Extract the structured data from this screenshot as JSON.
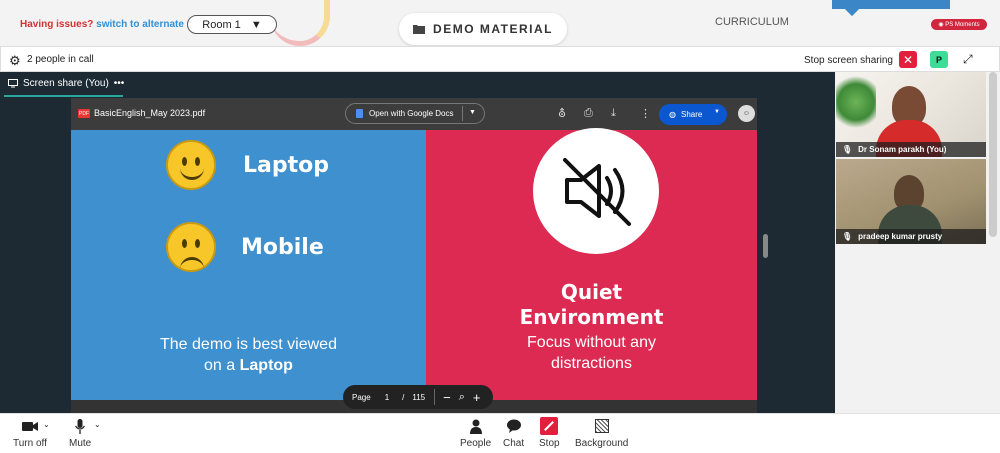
{
  "topbar": {
    "issues_text": "Having issues?",
    "alternate_link": "switch to alternate room",
    "room_select": "Room 1",
    "demo_tab": "DEMO MATERIAL",
    "curriculum": "CURRICULUM",
    "ps_moments": "PS Moments"
  },
  "callbar": {
    "people_count": "2 people in call",
    "stop_sharing": "Stop screen sharing",
    "participant_initial": "P"
  },
  "main": {
    "tab_label": "Screen share (You)",
    "tab_menu": "•••"
  },
  "pdf": {
    "filename": "BasicEnglish_May 2023.pdf",
    "open_with": "Open with Google Docs",
    "share": "Share",
    "page_label": "Page",
    "page_current": "1",
    "page_separator": "/",
    "page_total": "115"
  },
  "slide": {
    "laptop": "Laptop",
    "mobile": "Mobile",
    "demo_line1": "The demo is best viewed",
    "demo_line2_prefix": "on a ",
    "demo_line2_bold": "Laptop",
    "quiet_line1": "Quiet",
    "quiet_line2": "Environment",
    "focus_line1": "Focus without any",
    "focus_line2": "distractions"
  },
  "participants": [
    {
      "name": "Dr Sonam parakh (You)"
    },
    {
      "name": "pradeep kumar prusty"
    }
  ],
  "bottombar": {
    "turn_off": "Turn off",
    "mute": "Mute",
    "people": "People",
    "chat": "Chat",
    "stop": "Stop",
    "background": "Background"
  },
  "colors": {
    "slide_blue": "#3f90cf",
    "slide_red": "#dc2a52",
    "stop_red": "#e2203d",
    "share_blue": "#0b57d0"
  }
}
